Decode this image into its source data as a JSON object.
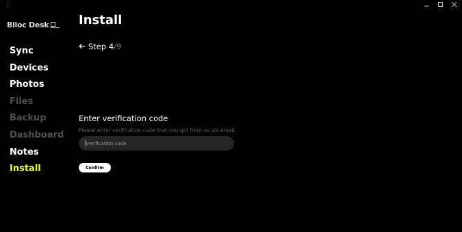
{
  "window": {
    "menu_icon": "vertical-dots-icon",
    "controls": [
      "minimize-icon",
      "maximize-icon",
      "close-icon"
    ]
  },
  "logo": {
    "text": "Blloc Desk",
    "icon": "desk-logo-icon"
  },
  "nav": {
    "items": [
      {
        "label": "Sync",
        "state": "enabled"
      },
      {
        "label": "Devices",
        "state": "enabled"
      },
      {
        "label": "Photos",
        "state": "enabled"
      },
      {
        "label": "Files",
        "state": "disabled"
      },
      {
        "label": "Backup",
        "state": "disabled"
      },
      {
        "label": "Dashboard",
        "state": "disabled"
      },
      {
        "label": "Notes",
        "state": "enabled"
      },
      {
        "label": "Install",
        "state": "active"
      }
    ]
  },
  "page": {
    "title": "Install"
  },
  "step": {
    "back_icon": "arrow-left-icon",
    "label": "Step 4",
    "total": "/9"
  },
  "verification": {
    "heading": "Enter verification code",
    "hint": "Please enter verification code that you got from us via email.",
    "placeholder": "verification code",
    "value": "",
    "button_label": "Confirm"
  },
  "colors": {
    "background": "#000000",
    "accent": "#e8ff2f",
    "disabled_text": "#4e4e4e",
    "input_background": "#262626"
  }
}
